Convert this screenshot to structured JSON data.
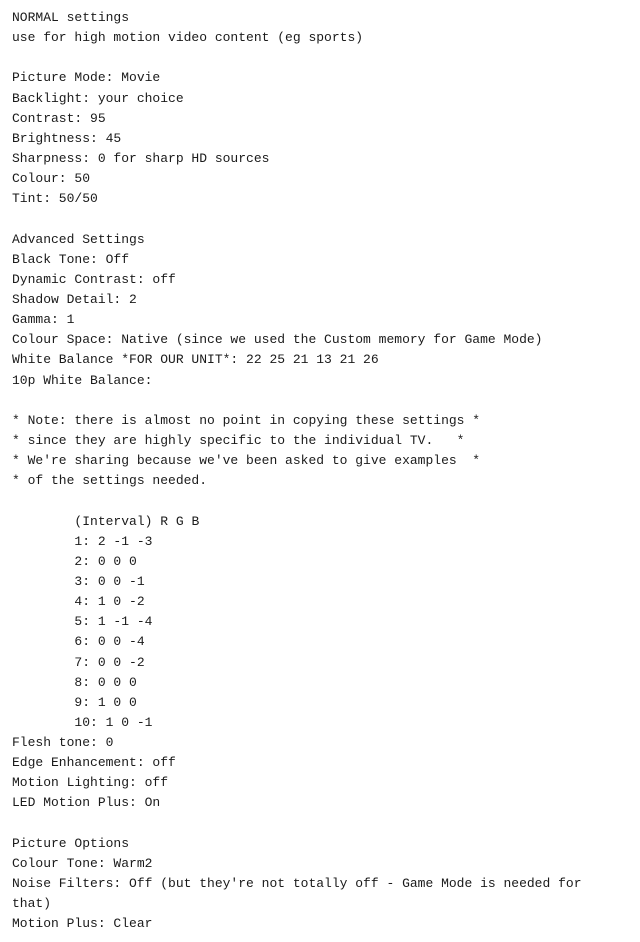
{
  "lines": [
    {
      "id": "line1",
      "text": "NORMAL settings"
    },
    {
      "id": "line2",
      "text": "use for high motion video content (eg sports)"
    },
    {
      "id": "line3",
      "text": ""
    },
    {
      "id": "line4",
      "text": "Picture Mode: Movie"
    },
    {
      "id": "line5",
      "text": "Backlight: your choice"
    },
    {
      "id": "line6",
      "text": "Contrast: 95"
    },
    {
      "id": "line7",
      "text": "Brightness: 45"
    },
    {
      "id": "line8",
      "text": "Sharpness: 0 for sharp HD sources"
    },
    {
      "id": "line9",
      "text": "Colour: 50"
    },
    {
      "id": "line10",
      "text": "Tint: 50/50"
    },
    {
      "id": "line11",
      "text": ""
    },
    {
      "id": "line12",
      "text": "Advanced Settings"
    },
    {
      "id": "line13",
      "text": "Black Tone: Off"
    },
    {
      "id": "line14",
      "text": "Dynamic Contrast: off"
    },
    {
      "id": "line15",
      "text": "Shadow Detail: 2"
    },
    {
      "id": "line16",
      "text": "Gamma: 1"
    },
    {
      "id": "line17",
      "text": "Colour Space: Native (since we used the Custom memory for Game Mode)"
    },
    {
      "id": "line18",
      "text": "White Balance *FOR OUR UNIT*: 22 25 21 13 21 26"
    },
    {
      "id": "line19",
      "text": "10p White Balance:"
    },
    {
      "id": "line20",
      "text": ""
    },
    {
      "id": "line21",
      "text": "* Note: there is almost no point in copying these settings *"
    },
    {
      "id": "line22",
      "text": "* since they are highly specific to the individual TV.   *"
    },
    {
      "id": "line23",
      "text": "* We're sharing because we've been asked to give examples  *"
    },
    {
      "id": "line24",
      "text": "* of the settings needed."
    },
    {
      "id": "line25",
      "text": ""
    },
    {
      "id": "line26",
      "text": "        (Interval) R G B"
    },
    {
      "id": "line27",
      "text": "        1: 2 -1 -3"
    },
    {
      "id": "line28",
      "text": "        2: 0 0 0"
    },
    {
      "id": "line29",
      "text": "        3: 0 0 -1"
    },
    {
      "id": "line30",
      "text": "        4: 1 0 -2"
    },
    {
      "id": "line31",
      "text": "        5: 1 -1 -4"
    },
    {
      "id": "line32",
      "text": "        6: 0 0 -4"
    },
    {
      "id": "line33",
      "text": "        7: 0 0 -2"
    },
    {
      "id": "line34",
      "text": "        8: 0 0 0"
    },
    {
      "id": "line35",
      "text": "        9: 1 0 0"
    },
    {
      "id": "line36",
      "text": "        10: 1 0 -1"
    },
    {
      "id": "line37",
      "text": "Flesh tone: 0"
    },
    {
      "id": "line38",
      "text": "Edge Enhancement: off"
    },
    {
      "id": "line39",
      "text": "Motion Lighting: off"
    },
    {
      "id": "line40",
      "text": "LED Motion Plus: On"
    },
    {
      "id": "line41",
      "text": ""
    },
    {
      "id": "line42",
      "text": "Picture Options"
    },
    {
      "id": "line43",
      "text": "Colour Tone: Warm2"
    },
    {
      "id": "line44",
      "text": "Noise Filters: Off (but they're not totally off - Game Mode is needed for that)"
    },
    {
      "id": "line45",
      "text": "Motion Plus: Clear"
    }
  ]
}
